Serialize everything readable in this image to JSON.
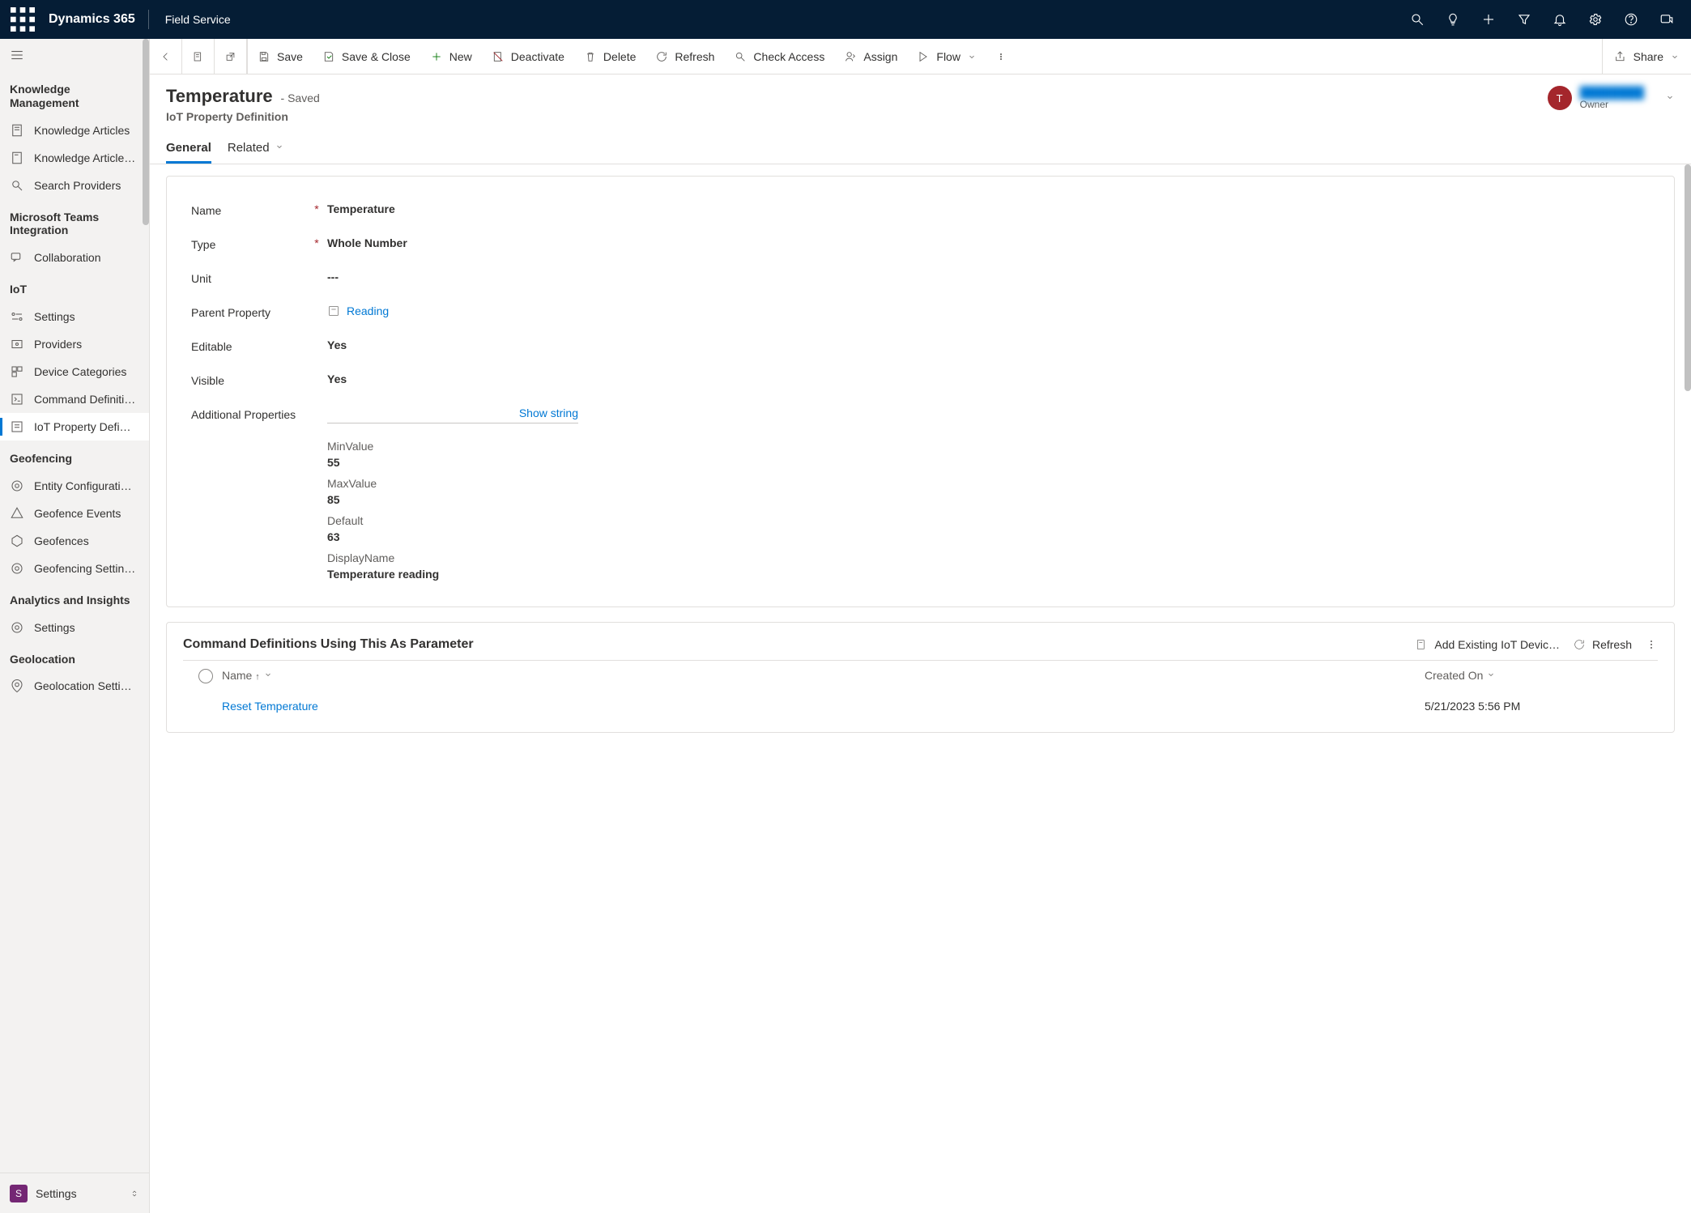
{
  "topbar": {
    "app_title": "Dynamics 365",
    "area": "Field Service"
  },
  "sidebar": {
    "groups": [
      {
        "title": "Knowledge Management",
        "items": [
          {
            "label": "Knowledge Articles"
          },
          {
            "label": "Knowledge Article…"
          },
          {
            "label": "Search Providers"
          }
        ]
      },
      {
        "title": "Microsoft Teams Integration",
        "items": [
          {
            "label": "Collaboration"
          }
        ]
      },
      {
        "title": "IoT",
        "items": [
          {
            "label": "Settings"
          },
          {
            "label": "Providers"
          },
          {
            "label": "Device Categories"
          },
          {
            "label": "Command Definiti…"
          },
          {
            "label": "IoT Property Defi…",
            "selected": true
          }
        ]
      },
      {
        "title": "Geofencing",
        "items": [
          {
            "label": "Entity Configurati…"
          },
          {
            "label": "Geofence Events"
          },
          {
            "label": "Geofences"
          },
          {
            "label": "Geofencing Settin…"
          }
        ]
      },
      {
        "title": "Analytics and Insights",
        "items": [
          {
            "label": "Settings"
          }
        ]
      },
      {
        "title": "Geolocation",
        "items": [
          {
            "label": "Geolocation Setti…"
          }
        ]
      }
    ],
    "area_switcher": {
      "badge": "S",
      "label": "Settings"
    }
  },
  "cmdbar": {
    "save": "Save",
    "saveclose": "Save & Close",
    "new": "New",
    "deactivate": "Deactivate",
    "delete": "Delete",
    "refresh": "Refresh",
    "checkaccess": "Check Access",
    "assign": "Assign",
    "flow": "Flow",
    "share": "Share"
  },
  "record": {
    "title": "Temperature",
    "status": "- Saved",
    "entity": "IoT Property Definition",
    "owner_initial": "T",
    "owner_name": "████████",
    "owner_label": "Owner"
  },
  "tabs": {
    "general": "General",
    "related": "Related"
  },
  "form": {
    "name_label": "Name",
    "name_value": "Temperature",
    "type_label": "Type",
    "type_value": "Whole Number",
    "unit_label": "Unit",
    "unit_value": "---",
    "parent_label": "Parent Property",
    "parent_value": "Reading",
    "editable_label": "Editable",
    "editable_value": "Yes",
    "visible_label": "Visible",
    "visible_value": "Yes",
    "addprops_label": "Additional Properties",
    "showstring": "Show string",
    "props": {
      "minvalue_label": "MinValue",
      "minvalue": "55",
      "maxvalue_label": "MaxValue",
      "maxvalue": "85",
      "default_label": "Default",
      "default": "63",
      "displayname_label": "DisplayName",
      "displayname": "Temperature reading"
    }
  },
  "subgrid": {
    "title": "Command Definitions Using This As Parameter",
    "add_existing": "Add Existing IoT Devic…",
    "refresh": "Refresh",
    "col_name": "Name",
    "col_created": "Created On",
    "row_name": "Reset Temperature",
    "row_created": "5/21/2023 5:56 PM"
  }
}
